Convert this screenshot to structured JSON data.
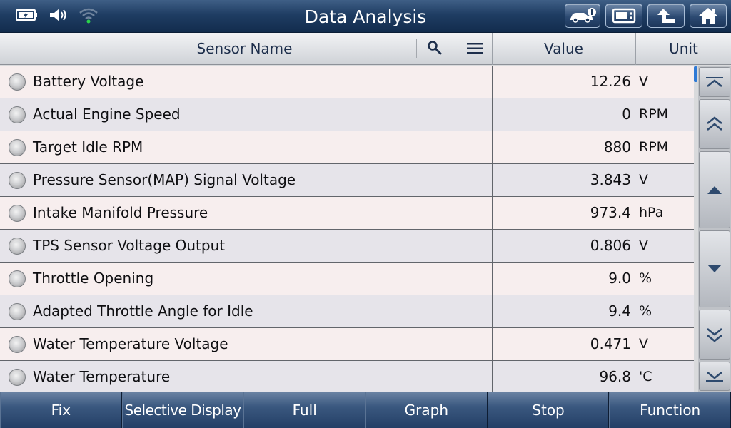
{
  "title_bar": {
    "title": "Data Analysis",
    "status_icons": [
      "battery-charging-icon",
      "speaker-icon",
      "wifi-icon"
    ],
    "buttons": [
      "car-info-icon",
      "monitor-icon",
      "back-up-icon",
      "home-icon"
    ]
  },
  "table": {
    "headers": {
      "name": "Sensor Name",
      "value": "Value",
      "unit": "Unit"
    },
    "rows": [
      {
        "name": "Battery Voltage",
        "value": "12.26",
        "unit": "V"
      },
      {
        "name": "Actual Engine Speed",
        "value": "0",
        "unit": "RPM"
      },
      {
        "name": "Target Idle RPM",
        "value": "880",
        "unit": "RPM"
      },
      {
        "name": "Pressure Sensor(MAP) Signal Voltage",
        "value": "3.843",
        "unit": "V"
      },
      {
        "name": "Intake Manifold Pressure",
        "value": "973.4",
        "unit": "hPa"
      },
      {
        "name": "TPS Sensor Voltage Output",
        "value": "0.806",
        "unit": "V"
      },
      {
        "name": "Throttle Opening",
        "value": "9.0",
        "unit": "%"
      },
      {
        "name": "Adapted Throttle Angle for Idle",
        "value": "9.4",
        "unit": "%"
      },
      {
        "name": "Water Temperature Voltage",
        "value": "0.471",
        "unit": "V"
      },
      {
        "name": "Water Temperature",
        "value": "96.8",
        "unit": "'C"
      }
    ]
  },
  "scroll_buttons": [
    "scroll-top-icon",
    "page-up-icon",
    "line-up-icon",
    "line-down-icon",
    "page-down-icon",
    "scroll-bottom-icon"
  ],
  "bottom_bar": {
    "fix": "Fix",
    "selective_display": "Selective Display",
    "full": "Full",
    "graph": "Graph",
    "stop": "Stop",
    "function": "Function"
  },
  "colors": {
    "title_bar": "#1f3d63",
    "row_odd": "#f7eeee",
    "row_even": "#e6e4ea",
    "bottom_bar": "#3a587f",
    "scroll_indicator": "#2f7ad6"
  }
}
